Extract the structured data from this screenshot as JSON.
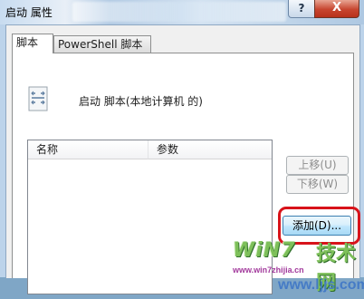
{
  "window": {
    "title": "启动 属性",
    "help_label": "?",
    "close_label": "X"
  },
  "tabs": [
    {
      "label": "脚本"
    },
    {
      "label": "PowerShell 脚本"
    }
  ],
  "panel": {
    "heading": "启动 脚本(本地计算机 的)",
    "columns": [
      "名称",
      "参数"
    ],
    "buttons": {
      "move_up": "上移(U)",
      "move_down": "下移(W)",
      "add": "添加(D)..."
    }
  },
  "watermark": {
    "logo": "WiN7",
    "logo2": "技术网",
    "url_small": "www.win7zhijia.cn",
    "url_large": "www.ljjs.com"
  },
  "colors": {
    "highlight_border": "#d8131a",
    "title_bar": "#b9d1ea"
  }
}
